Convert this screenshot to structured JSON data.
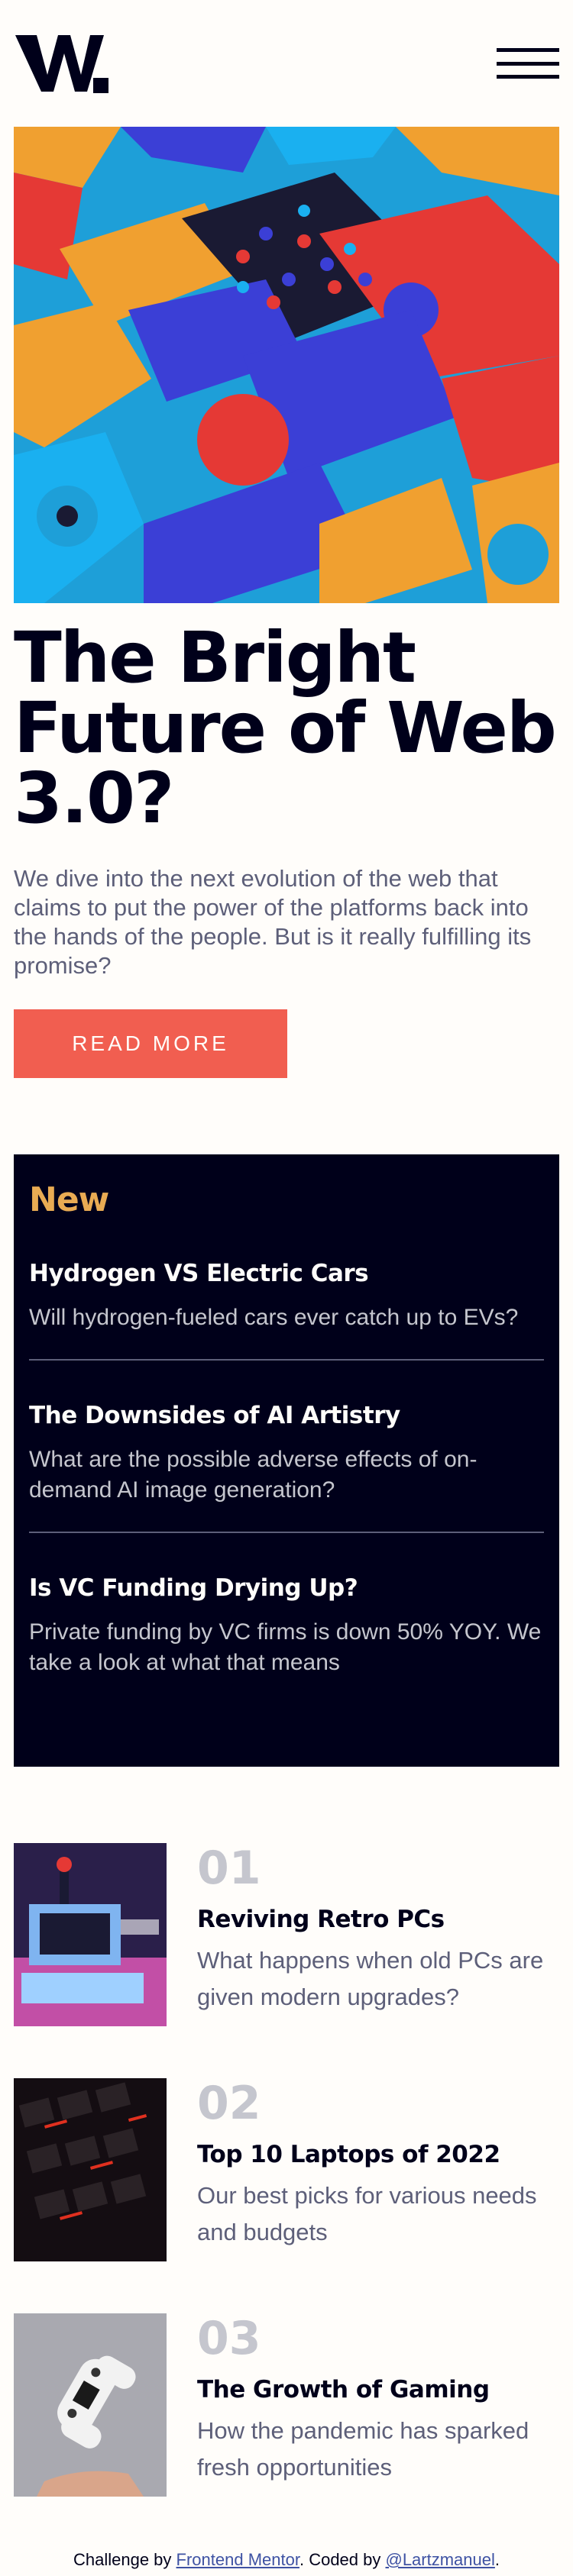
{
  "header": {
    "logo_alt": "W.",
    "menu_icon": "hamburger-icon"
  },
  "hero": {
    "image_icon": "abstract-3d-shapes-image",
    "title": "The Bright Future of Web 3.0?",
    "description": "We dive into the next evolution of the web that claims to put the power of the platforms back into the hands of the people. But is it really fulfilling its promise?",
    "button_label": "READ MORE"
  },
  "new_section": {
    "heading": "New",
    "items": [
      {
        "title": "Hydrogen VS Electric Cars",
        "description": "Will hydrogen-fueled cars ever catch up to EVs?"
      },
      {
        "title": "The Downsides of AI Artistry",
        "description": "What are the possible adverse effects of on-demand AI image generation?"
      },
      {
        "title": "Is VC Funding Drying Up?",
        "description": "Private funding by VC firms is down 50% YOY. We take a look at what that means"
      }
    ]
  },
  "ranked": [
    {
      "number": "01",
      "title": "Reviving Retro PCs",
      "description": "What happens when old PCs are given modern upgrades?",
      "image_icon": "retro-pc-image"
    },
    {
      "number": "02",
      "title": "Top 10 Laptops of 2022",
      "description": "Our best picks for various needs and budgets",
      "image_icon": "laptop-keyboard-image"
    },
    {
      "number": "03",
      "title": "The Growth of Gaming",
      "description": "How the pandemic has sparked fresh opportunities",
      "image_icon": "game-controller-image"
    }
  ],
  "footer": {
    "prefix": "Challenge by ",
    "link1": "Frontend Mentor",
    "middle": ". Coded by ",
    "link2": "@Lartzmanuel",
    "suffix": "."
  },
  "colors": {
    "accent_red": "#f15e50",
    "accent_orange": "#e9ab53",
    "dark": "#00001a",
    "muted": "#5d5f79",
    "background": "#fffdfa"
  }
}
